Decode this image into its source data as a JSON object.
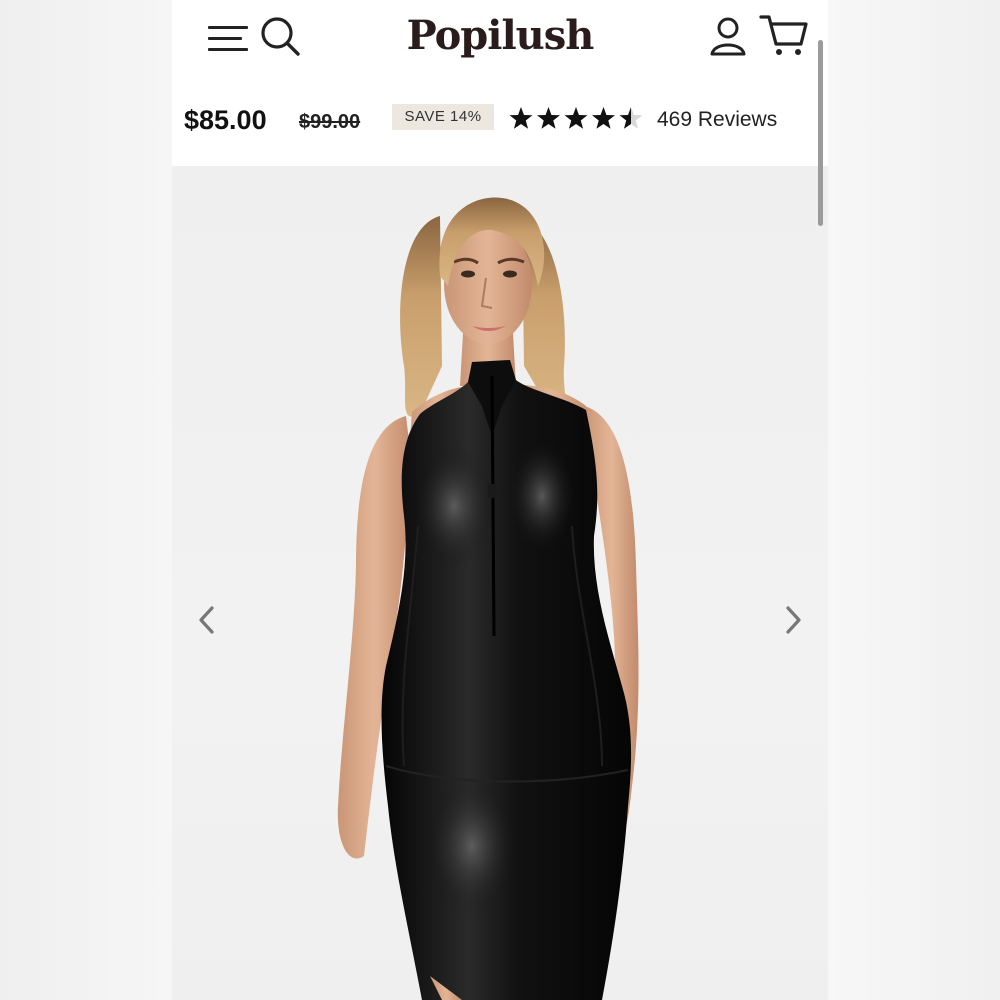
{
  "brand": {
    "name": "Popilush"
  },
  "header": {
    "menu_icon": "hamburger-menu-icon",
    "search_icon": "search-icon",
    "account_icon": "user-account-icon",
    "cart_icon": "shopping-cart-icon"
  },
  "product": {
    "price": "$85.00",
    "original_price": "$99.00",
    "save_badge": "SAVE 14%",
    "rating": 4.5,
    "rating_max": 5,
    "reviews_label": "469 Reviews"
  },
  "gallery": {
    "prev_icon": "chevron-left-icon",
    "next_icon": "chevron-right-icon"
  },
  "colors": {
    "brand_text": "#2a1c1c",
    "badge_bg": "#ece7df",
    "page_bg": "#ffffff",
    "gallery_bg": "#efefef",
    "dress": "#0f0f0f"
  }
}
